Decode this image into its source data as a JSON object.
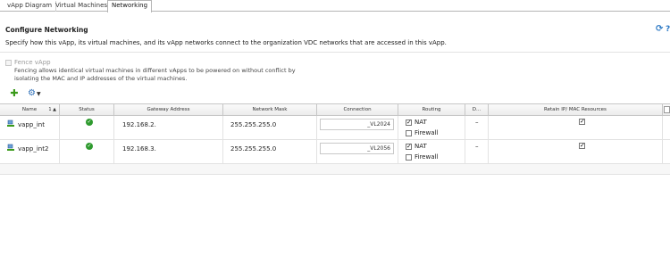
{
  "tabs": [
    {
      "label": "vApp Diagram"
    },
    {
      "label": "Virtual Machines"
    },
    {
      "label": "Networking"
    }
  ],
  "section": {
    "title": "Configure Networking",
    "description": "Specify how this vApp, its virtual machines, and its vApp networks connect to the organization VDC networks that are accessed in this vApp."
  },
  "fence": {
    "label": "Fence vApp",
    "checked": false,
    "help": "Fencing allows identical virtual machines in different vApps to be powered on without conflict by isolating the MAC and IP addresses of the virtual machines."
  },
  "toolbar": {
    "add_icon": "add-icon",
    "actions_icon": "gear-icon"
  },
  "grid": {
    "columns": [
      "Name",
      "1 ▲",
      "Status",
      "Gateway Address",
      "Network Mask",
      "Connection",
      "Routing",
      "D...",
      "Retain IP/ MAC Resources"
    ],
    "rows": [
      {
        "name": "vapp_int",
        "status": "ok",
        "gateway": "192.168.2.",
        "mask": "255.255.255.0",
        "connection": "_VL2024",
        "nat": true,
        "nat_label": "NAT",
        "firewall": false,
        "firewall_label": "Firewall",
        "dhcp": "–",
        "retain": true
      },
      {
        "name": "vapp_int2",
        "status": "ok",
        "gateway": "192.168.3.",
        "mask": "255.255.255.0",
        "connection": "_VL2056",
        "nat": true,
        "nat_label": "NAT",
        "firewall": false,
        "firewall_label": "Firewall",
        "dhcp": "–",
        "retain": true
      }
    ]
  },
  "colors": {
    "accent_blue": "#2b78c4",
    "add_green": "#3a9a1a",
    "status_ok": "#2e9a2e"
  }
}
